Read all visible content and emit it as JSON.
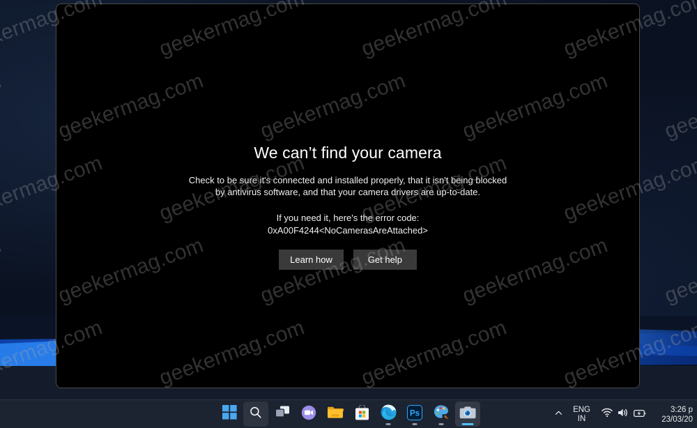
{
  "window": {
    "app_name": "Camera",
    "error": {
      "title": "We can’t find your camera",
      "description_line1": "Check to be sure it's connected and installed properly, that it isn't being blocked",
      "description_line2": "by antivirus software, and that your camera drivers are up-to-date.",
      "code_lead": "If you need it, here's the error code:",
      "code_value": "0xA00F4244<NoCamerasAreAttached>",
      "learn_how_label": "Learn how",
      "get_help_label": "Get help"
    }
  },
  "watermark": {
    "text": "geekermag.com",
    "color": "#a5a5a5"
  },
  "taskbar": {
    "items": [
      {
        "name": "start-button",
        "label": "Start",
        "icon": "windows-logo-icon",
        "state": "normal"
      },
      {
        "name": "search-button",
        "label": "Search",
        "icon": "search-icon",
        "state": "highlighted"
      },
      {
        "name": "task-view-button",
        "label": "Task View",
        "icon": "task-view-icon",
        "state": "normal"
      },
      {
        "name": "chat-button",
        "label": "Chat",
        "icon": "chat-video-icon",
        "state": "normal"
      },
      {
        "name": "file-explorer-button",
        "label": "File Explorer",
        "icon": "folder-icon",
        "state": "normal"
      },
      {
        "name": "microsoft-store-button",
        "label": "Microsoft Store",
        "icon": "store-bag-icon",
        "state": "normal"
      },
      {
        "name": "edge-button",
        "label": "Microsoft Edge",
        "icon": "edge-icon",
        "state": "running"
      },
      {
        "name": "photoshop-button",
        "label": "Adobe Photoshop",
        "icon": "photoshop-icon",
        "state": "running"
      },
      {
        "name": "paint-button",
        "label": "Paint",
        "icon": "paint-palette-icon",
        "state": "running"
      },
      {
        "name": "camera-button",
        "label": "Camera",
        "icon": "camera-icon",
        "state": "active"
      }
    ]
  },
  "tray": {
    "show_hidden_label": "⌃",
    "language_line1": "ENG",
    "language_line2": "IN",
    "network_icon": "wifi-icon",
    "volume_icon": "speaker-icon",
    "battery_icon": "battery-charging-icon",
    "clock_time": "3:26 p",
    "clock_date": "23/03/20"
  },
  "colors": {
    "accent": "#4cc2ff",
    "taskbar_bg": "#1d2431",
    "button_bg": "#3a3a3a",
    "window_bg": "#000000",
    "text_primary": "#ffffff"
  }
}
